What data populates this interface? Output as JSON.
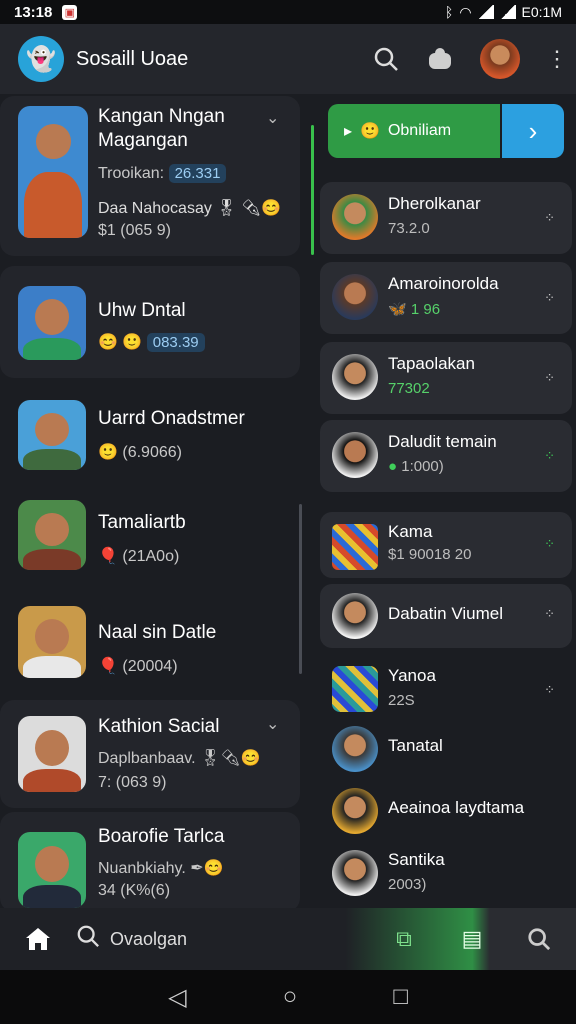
{
  "status_bar": {
    "time": "13:18",
    "battery": "E0:1M"
  },
  "app": {
    "title": "Sosaill Uoae"
  },
  "left_cards": [
    {
      "name": "Kangan Nngan",
      "name2": "Magangan",
      "sub": "Trooikan:",
      "badge": "26.331",
      "sub2": "Daa Nahocasay",
      "emoji2": "🎖 ✒😊",
      "sub3": "$1 (065 9)"
    },
    {
      "name": "Uhw Dntal",
      "sub": "😊 🙂",
      "badge": "083.39"
    },
    {
      "name": "Uarrd Onadstmer",
      "sub": "(6.9066)"
    },
    {
      "name": "Tamaliartb",
      "sub": "(21A0o)"
    },
    {
      "name": "Naal sin Datle",
      "sub": "(20004)"
    },
    {
      "name": "Kathion Sacial",
      "sub": "Daplbanbaav.",
      "emoji": "🎖✒😊",
      "sub2": "7: (063 9)"
    },
    {
      "name": "Boarofie Tarlca",
      "sub": "Nuanbkiahy.",
      "emoji": "✒😊",
      "sub2": "34 (K%(6)"
    }
  ],
  "action": {
    "label": "Obniliam",
    "arrow": "›"
  },
  "right_items": [
    {
      "name": "Dherolkanar",
      "sub": "73.2.0"
    },
    {
      "name": "Amaroinorolda",
      "sub": "🦋 1 96"
    },
    {
      "name": "Tapaolakan",
      "sub": "77302"
    },
    {
      "name": "Daludit temain",
      "sub": "1:000)"
    },
    {
      "name": "Kama",
      "sub": "$1 90018 20"
    },
    {
      "name": "Dabatin Viumel",
      "sub": ""
    },
    {
      "name": "Yanoa",
      "sub": "22S"
    },
    {
      "name": "Tanatal",
      "sub": ""
    },
    {
      "name": "Aeainoa laydtama",
      "sub": ""
    },
    {
      "name": "Santika",
      "sub": "2003)"
    }
  ],
  "bottom_nav": {
    "search_label": "Ovaolgan"
  },
  "colors": {
    "accent_green": "#2f9b45",
    "accent_blue": "#2ca0e0",
    "background": "#1b1d22"
  }
}
